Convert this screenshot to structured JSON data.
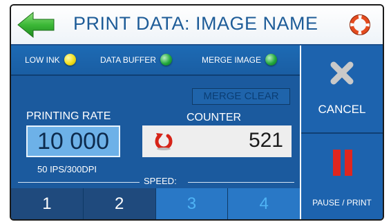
{
  "header": {
    "title": "PRINT DATA: IMAGE NAME",
    "back_icon": "back-arrow-icon",
    "help_icon": "lifebuoy-icon"
  },
  "status": {
    "low_ink": {
      "label": "LOW INK",
      "color": "#f1de1a"
    },
    "data_buffer": {
      "label": "DATA BUFFER",
      "color": "#22a83c"
    },
    "merge_image": {
      "label": "MERGE IMAGE",
      "color": "#22a83c"
    }
  },
  "merge_clear_label": "MERGE CLEAR",
  "printing_rate": {
    "label": "PRINTING RATE",
    "value": "10 000",
    "sub": "50 IPS/300DPI"
  },
  "counter": {
    "label": "COUNTER",
    "value": "521",
    "reset_icon": "reset-icon"
  },
  "speed": {
    "label": "SPEED:",
    "options": [
      "1",
      "2",
      "3",
      "4"
    ]
  },
  "side": {
    "cancel_label": "CANCEL",
    "cancel_icon": "close-x-icon",
    "pause_label": "PAUSE / PRINT",
    "pause_icon": "pause-icon"
  },
  "colors": {
    "panel": "#1b5a9e",
    "header_text": "#1e5c98",
    "pause_red": "#e0261f"
  }
}
